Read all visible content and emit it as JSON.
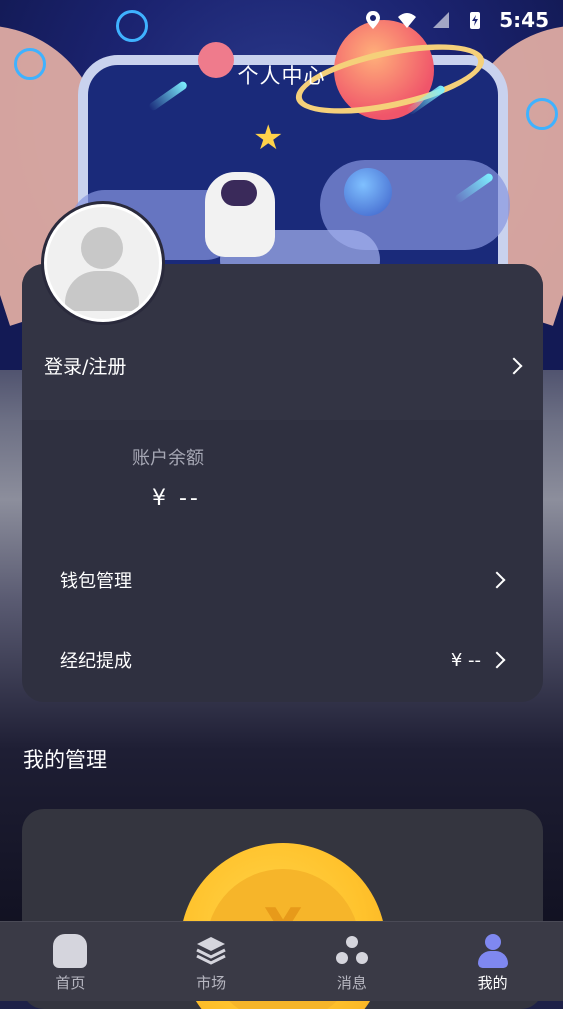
{
  "status_bar": {
    "time": "5:45",
    "icons": [
      "location-icon",
      "wifi-icon",
      "signal-icon",
      "battery-charging-icon"
    ]
  },
  "header": {
    "title": "个人中心"
  },
  "profile": {
    "login_label": "登录/注册"
  },
  "account": {
    "balance_label": "账户余额",
    "balance_value": "¥ --",
    "wallet_label": "钱包管理",
    "commission_label": "经纪提成",
    "commission_value": "¥ --"
  },
  "section": {
    "title": "我的管理"
  },
  "nav": {
    "items": [
      {
        "label": "首页",
        "icon": "home-icon",
        "active": false
      },
      {
        "label": "市场",
        "icon": "market-layers-icon",
        "active": false
      },
      {
        "label": "消息",
        "icon": "message-icon",
        "active": false
      },
      {
        "label": "我的",
        "icon": "person-icon",
        "active": true
      }
    ]
  },
  "colors": {
    "card_bg": "#353544",
    "nav_bg": "#3a3a46",
    "active_icon": "#7f88f0",
    "coin": "#ffc22c"
  }
}
